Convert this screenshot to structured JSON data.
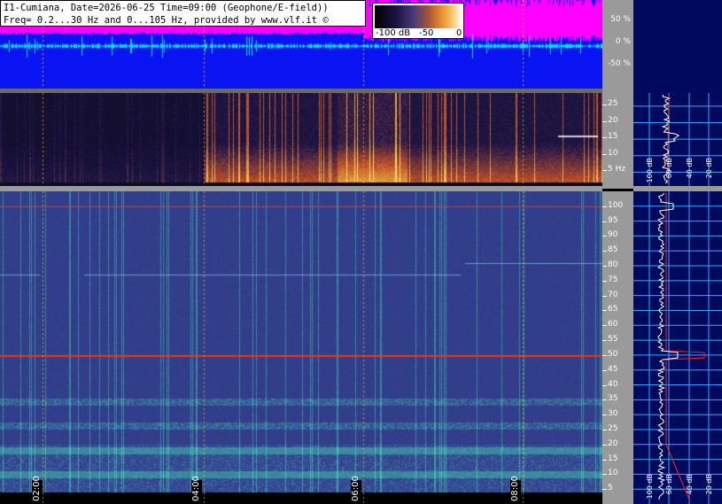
{
  "header": {
    "line1": "I1-Cumiana, Date=2026-06-25 Time=09:00 (Geophone/E-field))",
    "line2": "Freq= 0.2...30 Hz and 0...105 Hz, provided by www.vlf.it ©"
  },
  "colorbar": {
    "labels": [
      "-100 dB",
      "-50",
      "0"
    ]
  },
  "waveform_axis": {
    "labels": [
      "50 %",
      "0 %",
      "-50 %"
    ]
  },
  "ulf_axis": {
    "labels": [
      "25",
      "20",
      "15",
      "10",
      "5 Hz"
    ],
    "values": [
      25,
      20,
      15,
      10,
      5
    ],
    "max": 29
  },
  "elf_axis": {
    "labels": [
      "100",
      "95",
      "90",
      "85",
      "80",
      "75",
      "70",
      "65",
      "60",
      "55",
      "50",
      "45",
      "40",
      "35",
      "30",
      "25",
      "20",
      "15",
      "10",
      "5"
    ],
    "values": [
      100,
      95,
      90,
      85,
      80,
      75,
      70,
      65,
      60,
      55,
      50,
      45,
      40,
      35,
      30,
      25,
      20,
      15,
      10,
      5
    ],
    "max": 105
  },
  "time_axis": {
    "labels": [
      "02:00",
      "04:00",
      "06:00",
      "08:00"
    ]
  },
  "side_panel": {
    "ulf_labels": [
      "100 dB",
      "60 dB",
      "40 dB",
      "20 dB"
    ],
    "elf_labels": [
      "100 dB",
      "60 dB",
      "40 dB",
      "20 dB"
    ]
  },
  "colors": {
    "waveform_bg": "#0a14f2",
    "magenta_trace": "#ff00ff",
    "cyan_trace": "#00e0ff",
    "side_bg": "#000a5c",
    "grid_line": "#3aa6ff",
    "mains_line": "#ff3300"
  }
}
